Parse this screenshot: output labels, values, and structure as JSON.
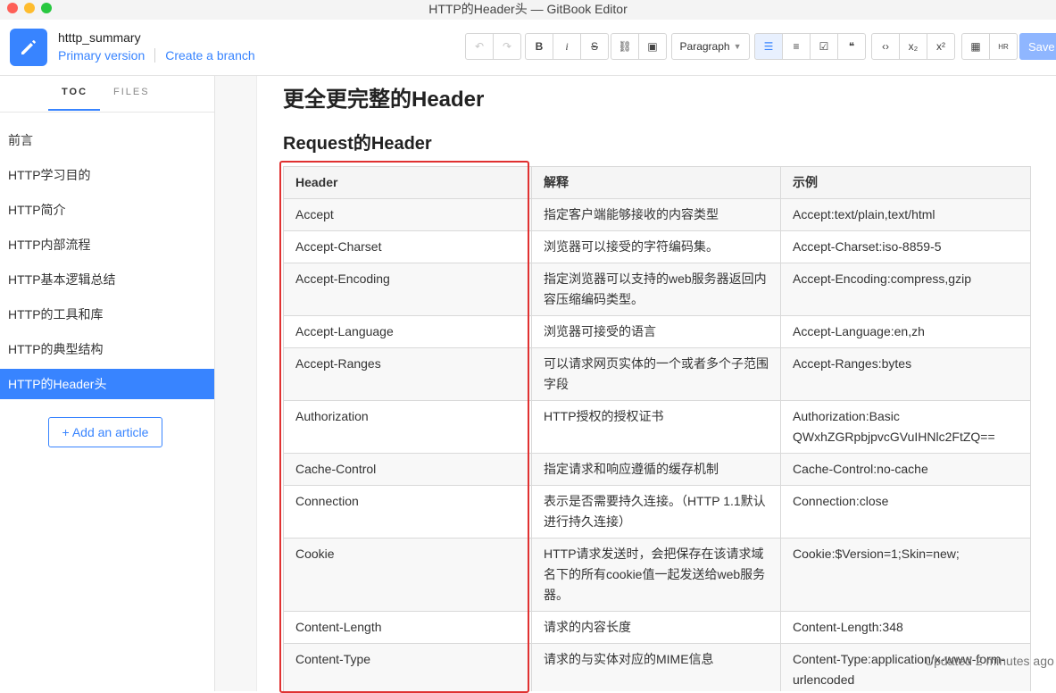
{
  "window": {
    "title": "HTTP的Header头 — GitBook Editor"
  },
  "header": {
    "book_name": "htttp_summary",
    "primary_version": "Primary version",
    "create_branch": "Create a branch",
    "paragraph_select": "Paragraph",
    "save_label": "Save"
  },
  "toolbar": {
    "groups": [
      [
        "undo-icon",
        "redo-icon"
      ],
      [
        "bold-icon",
        "italic-icon",
        "strikethrough-icon"
      ],
      [
        "link-icon",
        "image-icon"
      ],
      [
        "bullet-list-icon",
        "numbered-list-icon",
        "task-list-icon",
        "quote-icon"
      ],
      [
        "code-icon",
        "subscript-icon",
        "superscript-icon"
      ],
      [
        "table-icon",
        "html-icon"
      ]
    ]
  },
  "sidebar": {
    "tabs": {
      "toc": "TOC",
      "files": "FILES"
    },
    "items": [
      {
        "label": "前言"
      },
      {
        "label": "HTTP学习目的"
      },
      {
        "label": "HTTP简介"
      },
      {
        "label": "HTTP内部流程"
      },
      {
        "label": "HTTP基本逻辑总结"
      },
      {
        "label": "HTTP的工具和库"
      },
      {
        "label": "HTTP的典型结构"
      },
      {
        "label": "HTTP的Header头"
      }
    ],
    "add_article": "+ Add an article"
  },
  "content": {
    "heading1": "更全更完整的Header",
    "heading2": "Request的Header",
    "table": {
      "headers": [
        "Header",
        "解释",
        "示例"
      ],
      "rows": [
        [
          "Accept",
          "指定客户端能够接收的内容类型",
          "Accept:text/plain,text/html"
        ],
        [
          "Accept-Charset",
          "浏览器可以接受的字符编码集。",
          "Accept-Charset:iso-8859-5"
        ],
        [
          "Accept-Encoding",
          "指定浏览器可以支持的web服务器返回内容压缩编码类型。",
          "Accept-Encoding:compress,gzip"
        ],
        [
          "Accept-Language",
          "浏览器可接受的语言",
          "Accept-Language:en,zh"
        ],
        [
          "Accept-Ranges",
          "可以请求网页实体的一个或者多个子范围字段",
          "Accept-Ranges:bytes"
        ],
        [
          "Authorization",
          "HTTP授权的授权证书",
          "Authorization:Basic QWxhZGRpbjpvcGVuIHNlc2FtZQ=="
        ],
        [
          "Cache-Control",
          "指定请求和响应遵循的缓存机制",
          "Cache-Control:no-cache"
        ],
        [
          "Connection",
          "表示是否需要持久连接。（HTTP 1.1默认进行持久连接）",
          "Connection:close"
        ],
        [
          "Cookie",
          "HTTP请求发送时，会把保存在该请求域名下的所有cookie值一起发送给web服务器。",
          "Cookie:$Version=1;Skin=new;"
        ],
        [
          "Content-Length",
          "请求的内容长度",
          "Content-Length:348"
        ],
        [
          "Content-Type",
          "请求的与实体对应的MIME信息",
          "Content-Type:application/x-www-form-urlencoded"
        ]
      ]
    }
  },
  "status": {
    "updated": "Updated 2 minutes ago"
  }
}
